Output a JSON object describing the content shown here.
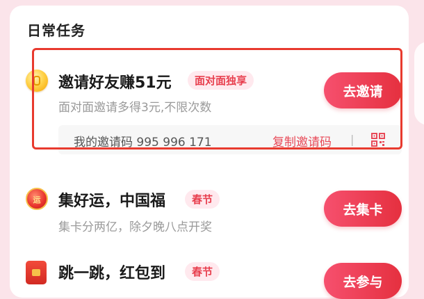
{
  "section": {
    "title": "日常任务"
  },
  "tasks": [
    {
      "title": "邀请好友赚51元",
      "badge": "面对面独享",
      "desc": "面对面邀请多得3元,不限次数",
      "button": "去邀请",
      "icon": "gold-coin-icon",
      "invite": {
        "code_label": "我的邀请码 995 996 171",
        "copy_label": "复制邀请码",
        "separator": "|",
        "qr_icon": "qr-code-icon"
      }
    },
    {
      "title": "集好运，中国福",
      "badge": "春节",
      "desc": "集卡分两亿，除夕晚八点开奖",
      "button": "去集卡",
      "icon": "fortune-coin-icon",
      "icon_text": "运"
    },
    {
      "title": "跳一跳，红包到",
      "badge": "春节",
      "button": "去参与",
      "icon": "red-envelope-icon"
    }
  ],
  "colors": {
    "accent": "#e5303f",
    "badge_bg": "#ffe9ee",
    "highlight": "#e83a2e",
    "page_bg": "#fbe4ea"
  }
}
